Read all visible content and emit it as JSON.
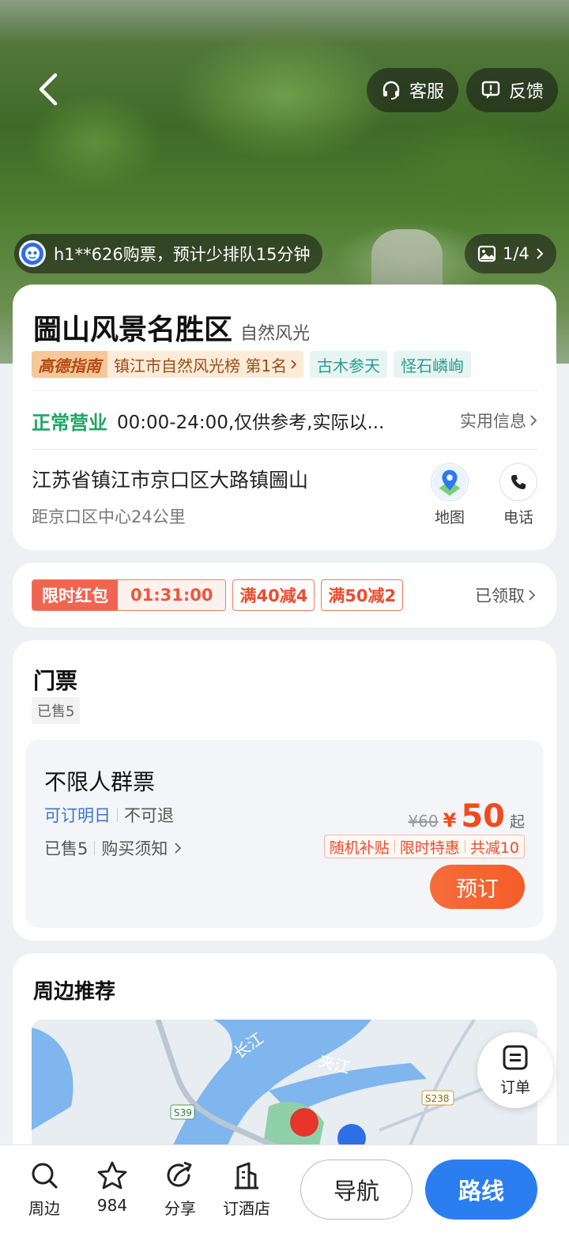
{
  "header": {
    "service_label": "客服",
    "feedback_label": "反馈",
    "buyer_notice": "h1**626购票，预计少排队15分钟",
    "photo_counter": "1/4"
  },
  "poi": {
    "name": "圌山风景名胜区",
    "category": "自然风光",
    "guide_logo": "高德指南",
    "ranking": "镇江市自然风光榜 第1名",
    "tags": [
      "古木参天",
      "怪石嶙峋"
    ],
    "status": "正常营业",
    "hours": "00:00-24:00,仅供参考,实际以...",
    "practical_info": "实用信息",
    "address": "江苏省镇江市京口区大路镇圌山",
    "distance": "距京口区中心24公里",
    "map_label": "地图",
    "phone_label": "电话"
  },
  "coupon": {
    "label": "限时红包",
    "countdown": "01:31:00",
    "deals": [
      "满40减4",
      "满50减2"
    ],
    "received": "已领取"
  },
  "tickets": {
    "title": "门票",
    "sold_badge": "已售5",
    "item": {
      "name": "不限人群票",
      "bookable": "可订明日",
      "refund": "不可退",
      "sold": "已售5",
      "notice": "购买须知",
      "original_price": "¥60",
      "currency": "¥",
      "price": "50",
      "price_suffix": "起",
      "promos": [
        "随机补贴",
        "限时特惠",
        "共减10"
      ],
      "book_label": "预订"
    }
  },
  "nearby": {
    "title": "周边推荐",
    "map_labels": [
      "长江",
      "夹江",
      "S39",
      "S238"
    ]
  },
  "order_fab": "订单",
  "bottom_bar": {
    "nearby": "周边",
    "favorites": "984",
    "share": "分享",
    "hotel": "订酒店",
    "navigate": "导航",
    "route": "路线"
  },
  "colors": {
    "accent_blue": "#2a7ef0",
    "open_green": "#1ea563",
    "price_red": "#f04a1e",
    "teal_tag": "#2b9d8f"
  }
}
